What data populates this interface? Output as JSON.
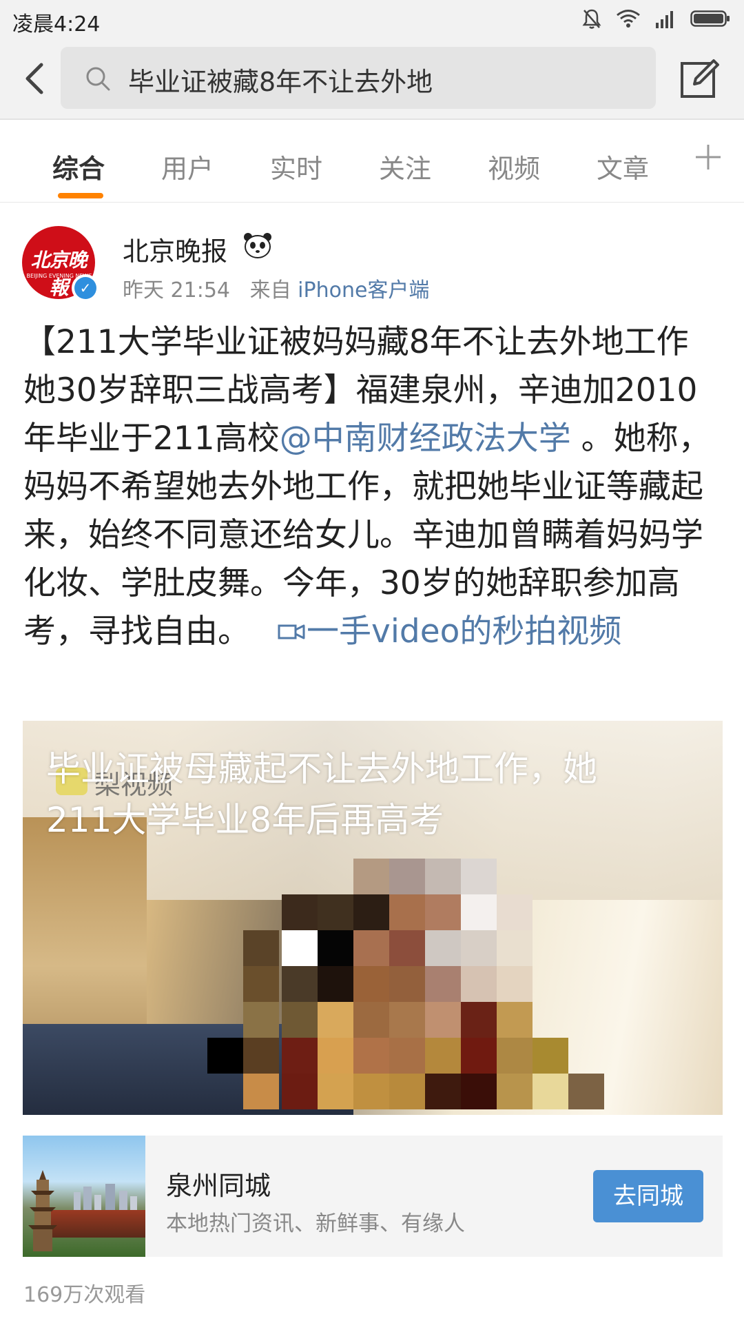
{
  "status_bar": {
    "time": "凌晨4:24",
    "icons": [
      "mute-icon",
      "wifi-icon",
      "signal-icon",
      "battery-icon"
    ]
  },
  "search": {
    "query": "毕业证被藏8年不让去外地"
  },
  "tabs": [
    {
      "label": "综合",
      "active": true
    },
    {
      "label": "用户"
    },
    {
      "label": "实时"
    },
    {
      "label": "关注"
    },
    {
      "label": "视频"
    },
    {
      "label": "文章"
    }
  ],
  "post": {
    "avatar_text": "北京晚報",
    "avatar_subtext": "BEIJING EVENING NEWS",
    "username": "北京晚报",
    "time": "昨天 21:54",
    "from_prefix": "来自",
    "source": "iPhone客户端",
    "text_main": "【211大学毕业证被妈妈藏8年不让去外地工作 她30岁辞职三战高考】福建泉州，辛迪加2010年毕业于211高校",
    "mention": "@中南财经政法大学",
    "text_rest": " 。她称，妈妈不希望她去外地工作，就把她毕业证等藏起来，始终不同意还给女儿。辛迪加曾瞒着妈妈学化妆、学肚皮舞。今年，30岁的她辞职参加高考，寻找自由。",
    "video_link": "一手video的秒拍视频"
  },
  "video": {
    "caption_line1": "毕业证被母藏起不让去外地工作，她",
    "caption_line2": "211大学毕业8年后再高考",
    "brand": "梨视频"
  },
  "promo": {
    "title": "泉州同城",
    "description": "本地热门资讯、新鲜事、有缘人",
    "button": "去同城"
  },
  "views": "169万次观看",
  "colors": {
    "accent_orange": "#ff8200",
    "link_blue": "#527aa8",
    "button_blue": "#4a90d4",
    "avatar_red": "#cf0e18"
  }
}
